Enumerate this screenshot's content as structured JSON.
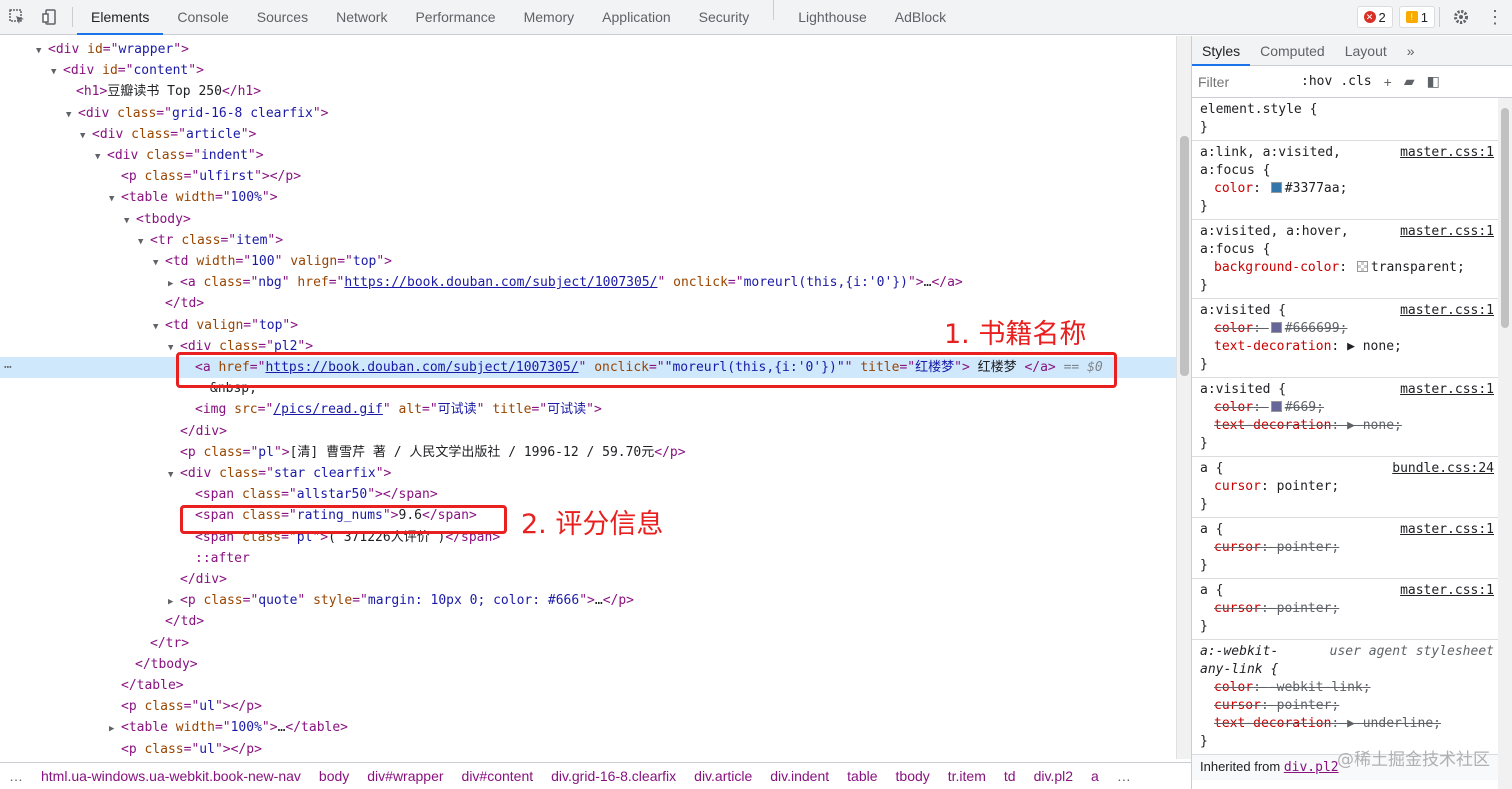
{
  "toolbar": {
    "tabs": [
      "Elements",
      "Console",
      "Sources",
      "Network",
      "Performance",
      "Memory",
      "Application",
      "Security",
      "Lighthouse",
      "AdBlock"
    ],
    "active_tab": "Elements",
    "error_count": "2",
    "warning_count": "1"
  },
  "tree": {
    "lines": [
      {
        "indent": 36,
        "tri": "▼",
        "html": "<span class='tg'>&lt;div</span> <span class='an'>id</span><span class='tg'>=\"</span><span class='av'>wrapper</span><span class='tg'>\"&gt;</span>"
      },
      {
        "indent": 51,
        "tri": "▼",
        "html": "<span class='tg'>&lt;div</span> <span class='an'>id</span><span class='tg'>=\"</span><span class='av'>content</span><span class='tg'>\"&gt;</span>"
      },
      {
        "indent": 76,
        "tri": "",
        "html": "<span class='tg'>&lt;h1&gt;</span><span class='tx'>豆瓣读书 Top 250</span><span class='tg'>&lt;/h1&gt;</span>"
      },
      {
        "indent": 66,
        "tri": "▼",
        "html": "<span class='tg'>&lt;div</span> <span class='an'>class</span><span class='tg'>=\"</span><span class='av'>grid-16-8 clearfix</span><span class='tg'>\"&gt;</span>"
      },
      {
        "indent": 80,
        "tri": "▼",
        "html": "<span class='tg'>&lt;div</span> <span class='an'>class</span><span class='tg'>=\"</span><span class='av'>article</span><span class='tg'>\"&gt;</span>"
      },
      {
        "indent": 95,
        "tri": "▼",
        "html": "<span class='tg'>&lt;div</span> <span class='an'>class</span><span class='tg'>=\"</span><span class='av'>indent</span><span class='tg'>\"&gt;</span>"
      },
      {
        "indent": 121,
        "tri": "",
        "html": "<span class='tg'>&lt;p</span> <span class='an'>class</span><span class='tg'>=\"</span><span class='av'>ulfirst</span><span class='tg'>\"&gt;&lt;/p&gt;</span>"
      },
      {
        "indent": 109,
        "tri": "▼",
        "html": "<span class='tg'>&lt;table</span> <span class='an'>width</span><span class='tg'>=\"</span><span class='av'>100%</span><span class='tg'>\"&gt;</span>"
      },
      {
        "indent": 124,
        "tri": "▼",
        "html": "<span class='tg'>&lt;tbody&gt;</span>"
      },
      {
        "indent": 138,
        "tri": "▼",
        "html": "<span class='tg'>&lt;tr</span> <span class='an'>class</span><span class='tg'>=\"</span><span class='av'>item</span><span class='tg'>\"&gt;</span>"
      },
      {
        "indent": 153,
        "tri": "▼",
        "html": "<span class='tg'>&lt;td</span> <span class='an'>width</span><span class='tg'>=\"</span><span class='av'>100</span><span class='tg'>\"</span> <span class='an'>valign</span><span class='tg'>=\"</span><span class='av'>top</span><span class='tg'>\"&gt;</span>"
      },
      {
        "indent": 168,
        "tri": "▶",
        "html": "<span class='tg'>&lt;a</span> <span class='an'>class</span><span class='tg'>=\"</span><span class='av'>nbg</span><span class='tg'>\"</span> <span class='an'>href</span><span class='tg'>=\"</span><span class='lk'>https://book.douban.com/subject/1007305/</span><span class='tg'>\"</span> <span class='an'>onclick</span><span class='tg'>=\"</span><span class='av'>moreurl(this,{i:'0'})</span><span class='tg'>\"&gt;</span><span class='tx'>…</span><span class='tg'>&lt;/a&gt;</span>"
      },
      {
        "indent": 165,
        "tri": "",
        "html": "<span class='tg'>&lt;/td&gt;</span>"
      },
      {
        "indent": 153,
        "tri": "▼",
        "html": "<span class='tg'>&lt;td</span> <span class='an'>valign</span><span class='tg'>=\"</span><span class='av'>top</span><span class='tg'>\"&gt;</span>"
      },
      {
        "indent": 168,
        "tri": "▼",
        "html": "<span class='tg'>&lt;div</span> <span class='an'>class</span><span class='tg'>=\"</span><span class='av'>pl2</span><span class='tg'>\"&gt;</span>"
      },
      {
        "indent": 195,
        "tri": "",
        "sel": true,
        "html": "<span class='tg'>&lt;a</span> <span class='an'>href</span><span class='tg'>=\"</span><span class='lk'>https://book.douban.com/subject/1007305/</span><span class='tg'>\"</span> <span class='an'>onclick</span><span class='tg'>=\"</span><span class='av'>\"moreurl(this,{i:'0'})\"</span><span class='tg'>\"</span> <span class='an'>title</span><span class='tg'>=\"</span><span class='av'>红楼梦</span><span class='tg'>\"&gt;</span><span class='tx'> 红楼梦 </span><span class='tg'>&lt;/a&gt;</span> <span class='dim'>==</span> <span class='dollar'>$0</span>"
      },
      {
        "indent": 210,
        "tri": "",
        "html": "<span class='tx'>&amp;nbsp;</span>"
      },
      {
        "indent": 195,
        "tri": "",
        "html": "<span class='tg'>&lt;img</span> <span class='an'>src</span><span class='tg'>=\"</span><span class='lk'>/pics/read.gif</span><span class='tg'>\"</span> <span class='an'>alt</span><span class='tg'>=\"</span><span class='av'>可试读</span><span class='tg'>\"</span> <span class='an'>title</span><span class='tg'>=\"</span><span class='av'>可试读</span><span class='tg'>\"&gt;</span>"
      },
      {
        "indent": 180,
        "tri": "",
        "html": "<span class='tg'>&lt;/div&gt;</span>"
      },
      {
        "indent": 180,
        "tri": "",
        "html": "<span class='tg'>&lt;p</span> <span class='an'>class</span><span class='tg'>=\"</span><span class='av'>pl</span><span class='tg'>\"&gt;</span><span class='tx'>[清] 曹雪芹 著 / 人民文学出版社 / 1996-12 / 59.70元</span><span class='tg'>&lt;/p&gt;</span>"
      },
      {
        "indent": 168,
        "tri": "▼",
        "html": "<span class='tg'>&lt;div</span> <span class='an'>class</span><span class='tg'>=\"</span><span class='av'>star clearfix</span><span class='tg'>\"&gt;</span>"
      },
      {
        "indent": 195,
        "tri": "",
        "html": "<span class='tg'>&lt;span</span> <span class='an'>class</span><span class='tg'>=\"</span><span class='av'>allstar50</span><span class='tg'>\"&gt;&lt;/span&gt;</span>"
      },
      {
        "indent": 195,
        "tri": "",
        "html": "<span class='tg'>&lt;span</span> <span class='an'>class</span><span class='tg'>=\"</span><span class='av'>rating_nums</span><span class='tg'>\"&gt;</span><span class='tx'>9.6</span><span class='tg'>&lt;/span&gt;</span>"
      },
      {
        "indent": 195,
        "tri": "",
        "html": "<span class='tg'>&lt;span</span> <span class='an'>class</span><span class='tg'>=\"</span><span class='av'>pl</span><span class='tg'>\"&gt;</span><span class='tx'>( 371226人评价 )</span><span class='tg'>&lt;/span&gt;</span>"
      },
      {
        "indent": 195,
        "tri": "",
        "html": "<span class='ps'>::after</span>"
      },
      {
        "indent": 180,
        "tri": "",
        "html": "<span class='tg'>&lt;/div&gt;</span>"
      },
      {
        "indent": 168,
        "tri": "▶",
        "html": "<span class='tg'>&lt;p</span> <span class='an'>class</span><span class='tg'>=\"</span><span class='av'>quote</span><span class='tg'>\"</span> <span class='an'>style</span><span class='tg'>=\"</span><span class='av'>margin: 10px 0; color: #666</span><span class='tg'>\"&gt;</span><span class='tx'>…</span><span class='tg'>&lt;/p&gt;</span>"
      },
      {
        "indent": 165,
        "tri": "",
        "html": "<span class='tg'>&lt;/td&gt;</span>"
      },
      {
        "indent": 150,
        "tri": "",
        "html": "<span class='tg'>&lt;/tr&gt;</span>"
      },
      {
        "indent": 135,
        "tri": "",
        "html": "<span class='tg'>&lt;/tbody&gt;</span>"
      },
      {
        "indent": 121,
        "tri": "",
        "html": "<span class='tg'>&lt;/table&gt;</span>"
      },
      {
        "indent": 121,
        "tri": "",
        "html": "<span class='tg'>&lt;p</span> <span class='an'>class</span><span class='tg'>=\"</span><span class='av'>ul</span><span class='tg'>\"&gt;&lt;/p&gt;</span>"
      },
      {
        "indent": 109,
        "tri": "▶",
        "html": "<span class='tg'>&lt;table</span> <span class='an'>width</span><span class='tg'>=\"</span><span class='av'>100%</span><span class='tg'>\"&gt;</span><span class='tx'>…</span><span class='tg'>&lt;/table&gt;</span>"
      },
      {
        "indent": 121,
        "tri": "",
        "html": "<span class='tg'>&lt;p</span> <span class='an'>class</span><span class='tg'>=\"</span><span class='av'>ul</span><span class='tg'>\"&gt;&lt;/p&gt;</span>"
      }
    ]
  },
  "annotations": {
    "label1": "1. 书籍名称",
    "label2": "2. 评分信息",
    "color": "#e8201f"
  },
  "styles_pane": {
    "tabs": [
      "Styles",
      "Computed",
      "Layout"
    ],
    "more": "»",
    "filter_placeholder": "Filter",
    "hov": ":hov",
    "cls": ".cls",
    "rules": [
      {
        "selector": "element.style {",
        "source": "",
        "props": [],
        "close": "}"
      },
      {
        "selector": "a:link, a:visited,\na:focus {",
        "source": "master.css:1",
        "props": [
          {
            "name": "color",
            "value": "#3377aa",
            "swatch": "#3377aa",
            "struck": false
          }
        ],
        "close": "}"
      },
      {
        "selector": "a:visited, a:hover,\na:focus {",
        "source": "master.css:1",
        "props": [
          {
            "name": "background-color",
            "value": "transparent",
            "swatch": "transparent",
            "struck": false
          }
        ],
        "close": "}"
      },
      {
        "selector": "a:visited {",
        "source": "master.css:1",
        "props": [
          {
            "name": "color",
            "value": "#666699",
            "swatch": "#666699",
            "struck": true
          },
          {
            "name": "text-decoration",
            "value": "▶ none",
            "swatch": "",
            "struck": false
          }
        ],
        "close": "}"
      },
      {
        "selector": "a:visited {",
        "source": "master.css:1",
        "props": [
          {
            "name": "color",
            "value": "#669",
            "swatch": "#666699",
            "struck": true
          },
          {
            "name": "text-decoration",
            "value": "▶ none",
            "swatch": "",
            "struck": true
          }
        ],
        "close": "}"
      },
      {
        "selector": "a {",
        "source": "bundle.css:24",
        "props": [
          {
            "name": "cursor",
            "value": "pointer",
            "swatch": "",
            "struck": false
          }
        ],
        "close": "}"
      },
      {
        "selector": "a {",
        "source": "master.css:1",
        "props": [
          {
            "name": "cursor",
            "value": "pointer",
            "swatch": "",
            "struck": true
          }
        ],
        "close": "}"
      },
      {
        "selector": "a {",
        "source": "master.css:1",
        "props": [
          {
            "name": "cursor",
            "value": "pointer",
            "swatch": "",
            "struck": true
          }
        ],
        "close": "}"
      },
      {
        "selector": "a:-webkit-\nany-link {",
        "source": "user agent stylesheet",
        "ua": true,
        "props": [
          {
            "name": "color",
            "value": "-webkit-link",
            "swatch": "",
            "struck": true
          },
          {
            "name": "cursor",
            "value": "pointer",
            "swatch": "",
            "struck": true
          },
          {
            "name": "text-decoration",
            "value": "▶ underline",
            "swatch": "",
            "struck": true
          }
        ],
        "close": "}"
      }
    ],
    "inherited_label": "Inherited from",
    "inherited_from": "div.pl2"
  },
  "breadcrumbs": [
    "html.ua-windows.ua-webkit.book-new-nav",
    "body",
    "div#wrapper",
    "div#content",
    "div.grid-16-8.clearfix",
    "div.article",
    "div.indent",
    "table",
    "tbody",
    "tr.item",
    "td",
    "div.pl2",
    "a"
  ],
  "watermark": "@稀土掘金技术社区"
}
